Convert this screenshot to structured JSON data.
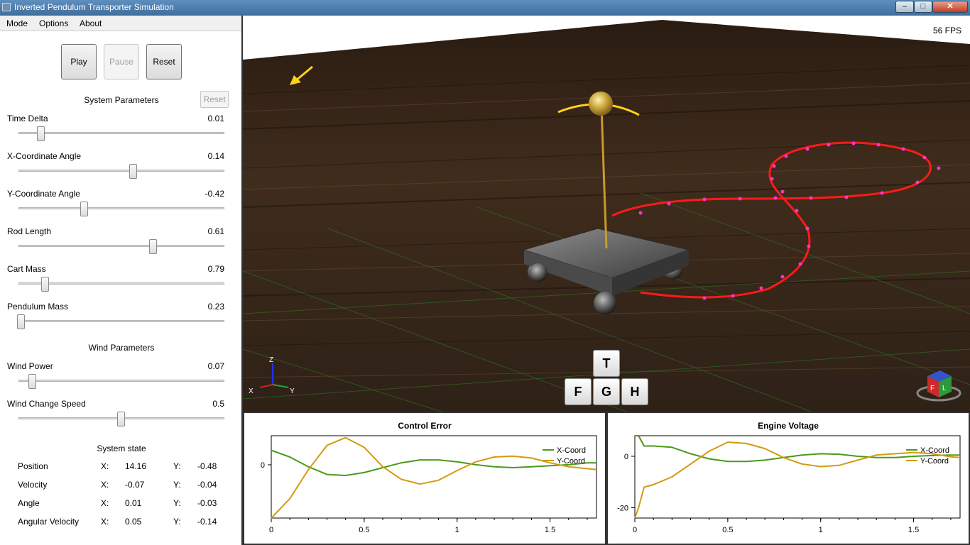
{
  "window": {
    "title": "Inverted Pendulum Transporter Simulation"
  },
  "menu": [
    "Mode",
    "Options",
    "About"
  ],
  "playback": {
    "play": "Play",
    "pause": "Pause",
    "reset": "Reset"
  },
  "system_params": {
    "header": "System Parameters",
    "reset": "Reset",
    "items": [
      {
        "label": "Time Delta",
        "value": "0.01"
      },
      {
        "label": "X-Coordinate Angle",
        "value": "0.14"
      },
      {
        "label": "Y-Coordinate Angle",
        "value": "-0.42"
      },
      {
        "label": "Rod Length",
        "value": "0.61"
      },
      {
        "label": "Cart Mass",
        "value": "0.79"
      },
      {
        "label": "Pendulum Mass",
        "value": "0.23"
      }
    ]
  },
  "wind_params": {
    "header": "Wind Parameters",
    "items": [
      {
        "label": "Wind Power",
        "value": "0.07"
      },
      {
        "label": "Wind Change Speed",
        "value": "0.5"
      }
    ]
  },
  "system_state": {
    "header": "System state",
    "x_label": "X:",
    "y_label": "Y:",
    "rows": [
      {
        "label": "Position",
        "x": "14.16",
        "y": "-0.48"
      },
      {
        "label": "Velocity",
        "x": "-0.07",
        "y": "-0.04"
      },
      {
        "label": "Angle",
        "x": "0.01",
        "y": "-0.03"
      },
      {
        "label": "Angular Velocity",
        "x": "0.05",
        "y": "-0.14"
      }
    ]
  },
  "viewport": {
    "fps": "56 FPS",
    "keys": [
      "T",
      "F",
      "G",
      "H"
    ],
    "axes": {
      "x": "X",
      "y": "Y",
      "z": "Z"
    },
    "cube_faces": [
      "F",
      "L"
    ]
  },
  "colors": {
    "x_series": "#4a9a1a",
    "y_series": "#d49a10",
    "trajectory": "#ff1a1a",
    "trajectory_points": "#ff33cc"
  },
  "chart_data": [
    {
      "type": "line",
      "title": "Control Error",
      "x_ticks": [
        "0",
        "0.5",
        "1",
        "1.5"
      ],
      "y_ticks": [
        "0"
      ],
      "xlim": [
        0,
        1.75
      ],
      "ylim": [
        -0.55,
        0.3
      ],
      "series": [
        {
          "name": "X-Coord",
          "x": [
            0,
            0.1,
            0.2,
            0.3,
            0.4,
            0.5,
            0.6,
            0.7,
            0.8,
            0.9,
            1.0,
            1.1,
            1.2,
            1.3,
            1.4,
            1.5,
            1.6,
            1.7,
            1.75
          ],
          "y": [
            0.15,
            0.08,
            -0.02,
            -0.1,
            -0.11,
            -0.08,
            -0.03,
            0.02,
            0.05,
            0.05,
            0.03,
            0.0,
            -0.02,
            -0.03,
            -0.02,
            -0.01,
            0.0,
            0.02,
            0.02
          ]
        },
        {
          "name": "Y-Coord",
          "x": [
            0,
            0.1,
            0.2,
            0.3,
            0.4,
            0.5,
            0.6,
            0.7,
            0.8,
            0.9,
            1.0,
            1.1,
            1.2,
            1.3,
            1.4,
            1.5,
            1.6,
            1.7,
            1.75
          ],
          "y": [
            -0.55,
            -0.35,
            -0.05,
            0.2,
            0.28,
            0.18,
            -0.02,
            -0.15,
            -0.2,
            -0.16,
            -0.06,
            0.03,
            0.08,
            0.09,
            0.07,
            0.02,
            -0.02,
            -0.04,
            -0.05
          ]
        }
      ]
    },
    {
      "type": "line",
      "title": "Engine Voltage",
      "x_ticks": [
        "0",
        "0.5",
        "1",
        "1.5"
      ],
      "y_ticks": [
        "0",
        "-20"
      ],
      "xlim": [
        0,
        1.75
      ],
      "ylim": [
        -24,
        8
      ],
      "series": [
        {
          "name": "X-Coord",
          "x": [
            0,
            0.02,
            0.05,
            0.1,
            0.2,
            0.3,
            0.4,
            0.5,
            0.6,
            0.7,
            0.8,
            0.9,
            1.0,
            1.1,
            1.2,
            1.3,
            1.4,
            1.5,
            1.6,
            1.7,
            1.75
          ],
          "y": [
            8,
            8,
            4,
            4,
            3.5,
            1,
            -1,
            -2,
            -2,
            -1.5,
            -0.5,
            0.5,
            1,
            0.8,
            0,
            -0.5,
            -0.5,
            0,
            0.3,
            0.5,
            0.5
          ]
        },
        {
          "name": "Y-Coord",
          "x": [
            0,
            0.02,
            0.05,
            0.1,
            0.2,
            0.3,
            0.4,
            0.5,
            0.6,
            0.7,
            0.8,
            0.9,
            1.0,
            1.1,
            1.2,
            1.3,
            1.4,
            1.5,
            1.6,
            1.7,
            1.75
          ],
          "y": [
            -24,
            -20,
            -12,
            -11,
            -8,
            -3,
            2,
            5.5,
            5,
            3,
            -0.5,
            -3,
            -4,
            -3.5,
            -1.5,
            0.5,
            1,
            1.5,
            1,
            -0.2,
            -0.5
          ]
        }
      ]
    }
  ]
}
